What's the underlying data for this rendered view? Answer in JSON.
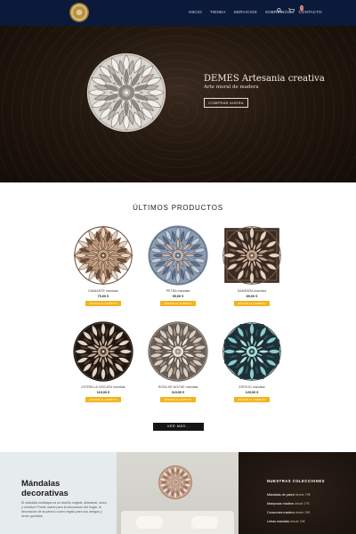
{
  "header": {
    "nav": [
      "INICIO",
      "TIENDA",
      "SERVICIOS",
      "SOBRE NOS",
      "CONTACTO"
    ],
    "cart_count": "0",
    "icons": [
      "search-icon",
      "cart-icon"
    ]
  },
  "hero": {
    "title": "DEMES Artesania creativa",
    "subtitle": "Arte mural de madera",
    "button": "COMPRAR AHORA"
  },
  "products_section": {
    "title": "ÚLTIMOS PRODUCTOS",
    "items": [
      {
        "name": "DIAMANTE mandala",
        "price": "79,00 €",
        "button": "AÑADIR AL CARRITO"
      },
      {
        "name": "PETRA mandala",
        "price": "99,00 €",
        "button": "AÑADIR AL CARRITO"
      },
      {
        "name": "SAMSARA mandala",
        "price": "89,00 €",
        "button": "AÑADIR AL CARRITO"
      },
      {
        "name": "ESTRELLA OSCURA mandala",
        "price": "119,00 €",
        "button": "AÑADIR AL CARRITO"
      },
      {
        "name": "ROSA DE NOCHE mandala",
        "price": "119,00 €",
        "button": "AÑADIR AL CARRITO"
      },
      {
        "name": "ESPEJO mandala",
        "price": "129,00 €",
        "button": "AÑADIR AL CARRITO"
      }
    ],
    "more_button": "VER MÁS..."
  },
  "bottom": {
    "heading_line1": "Mándalas",
    "heading_line2": "decorativas",
    "text": "El mándala multicapa es un diseño original, artesanal, único y creativo! Puede usarlo para la decoración del hogar, la decoración de la pared o como regalo para sus amigos y seres queridos.",
    "collections_title": "NUESTRAS COLECCIONES",
    "collections": [
      {
        "name": "Mándalas de pared",
        "from": "desde 79€"
      },
      {
        "name": "Mariposas madera",
        "from": "desde 27€"
      },
      {
        "name": "Corazones madera",
        "from": "desde 25€"
      },
      {
        "name": "Letras mandala",
        "from": "desde 15€"
      }
    ]
  },
  "colors": {
    "header_bg": "#0b1a3a",
    "cart_button": "#f2b41c",
    "more_button": "#151515"
  }
}
